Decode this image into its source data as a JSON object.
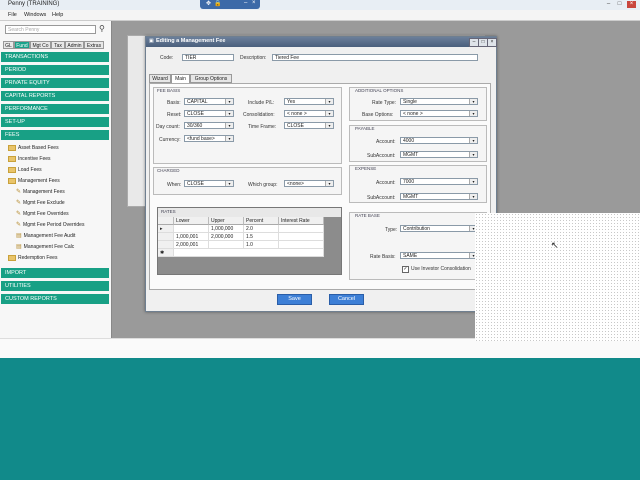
{
  "app": {
    "title": "Penny (TRAINING)"
  },
  "menu": [
    "File",
    "Windows",
    "Help"
  ],
  "sidebar": {
    "search_placeholder": "Search Penny",
    "tabs": [
      "GL",
      "Fund",
      "Mgt Co",
      "Tax",
      "Admin",
      "Extras"
    ],
    "sections_top": [
      "TRANSACTIONS",
      "PERIOD",
      "PRIVATE EQUITY",
      "CAPITAL REPORTS",
      "PERFORMANCE",
      "SET-UP",
      "FEES"
    ],
    "fees_tree": [
      {
        "label": "Asset Based Fees",
        "kind": "folder",
        "level": 1
      },
      {
        "label": "Incentive Fees",
        "kind": "folder",
        "level": 1
      },
      {
        "label": "Load Fees",
        "kind": "folder",
        "level": 1
      },
      {
        "label": "Management Fees",
        "kind": "folder",
        "level": 1
      },
      {
        "label": "Management Fees",
        "kind": "item",
        "level": 2
      },
      {
        "label": "Mgmt Fee Exclude",
        "kind": "item",
        "level": 2
      },
      {
        "label": "Mgmt Fee Overrides",
        "kind": "item",
        "level": 2
      },
      {
        "label": "Mgmt Fee Period Overrides",
        "kind": "item",
        "level": 2
      },
      {
        "label": "Management Fee Audit",
        "kind": "item",
        "level": 2
      },
      {
        "label": "Management Fee Calc",
        "kind": "item",
        "level": 2
      },
      {
        "label": "Redemption Fees",
        "kind": "folder",
        "level": 1
      }
    ],
    "sections_bottom": [
      "IMPORT",
      "UTILITIES",
      "CUSTOM REPORTS"
    ]
  },
  "dialog": {
    "title": "Editing a Management Fee",
    "code_label": "Code:",
    "code_value": "TIER",
    "description_label": "Description:",
    "description_value": "Tiered Fee",
    "tabs": [
      "Wizard",
      "Main",
      "Group Options"
    ],
    "fee_basis": {
      "title": "FEE BASIS",
      "basis_label": "Basis:",
      "basis_value": "CAPITAL",
      "include_pl_label": "Include P/L:",
      "include_pl_value": "Yes",
      "reset_label": "Reset:",
      "reset_value": "CLOSE",
      "consolidation_label": "Consolidation:",
      "consolidation_value": "< none >",
      "daycount_label": "Day count:",
      "daycount_value": "30/360",
      "timeframe_label": "Time Frame:",
      "timeframe_value": "CLOSE",
      "currency_label": "Currency:",
      "currency_value": "<fund base>"
    },
    "charged": {
      "title": "CHARGED",
      "when_label": "When:",
      "when_value": "CLOSE",
      "which_group_label": "Which group:",
      "which_group_value": "<none>"
    },
    "rates": {
      "title": "RATES",
      "headers": [
        "Lower",
        "Upper",
        "Percent",
        "Interest Rate"
      ],
      "rows": [
        [
          "",
          "1,000,000",
          "2.0",
          ""
        ],
        [
          "1,000,001",
          "2,000,000",
          "1.5",
          ""
        ],
        [
          "2,000,001",
          "",
          "1.0",
          ""
        ]
      ]
    },
    "additional_options": {
      "title": "ADDITIONAL OPTIONS",
      "rate_type_label": "Rate Type:",
      "rate_type_value": "Single",
      "base_options_label": "Base Options:",
      "base_options_value": "< none >"
    },
    "payable": {
      "title": "PAYABLE",
      "account_label": "Account:",
      "account_value": "4000",
      "subaccount_label": "SubAccount:",
      "subaccount_value": "MGMT"
    },
    "expense": {
      "title": "EXPENSE",
      "account_label": "Account:",
      "account_value": "7000",
      "subaccount_label": "SubAccount:",
      "subaccount_value": "MGMT"
    },
    "rate_base": {
      "title": "RATE BASE",
      "type_label": "Type:",
      "type_value": "Contribution",
      "rate_basis_label": "Rate Basis:",
      "rate_basis_value": "SAME",
      "use_investor_label": "Use Investor Consolidation"
    },
    "save_label": "Save",
    "cancel_label": "Cancel"
  }
}
